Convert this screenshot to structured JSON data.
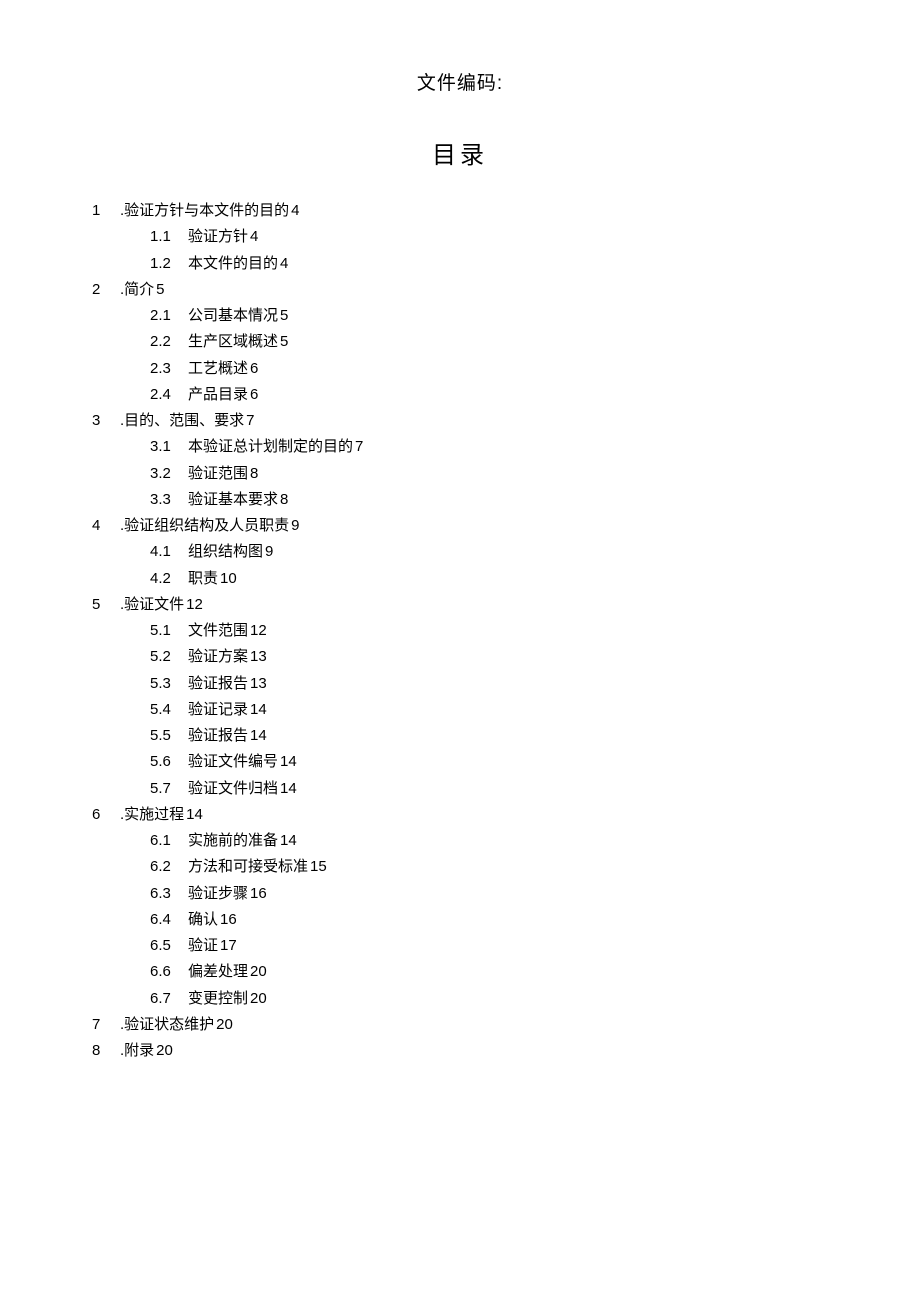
{
  "header": "文件编码:",
  "title": "目录",
  "toc": [
    {
      "level": 1,
      "num": "1",
      "label": ".验证方针与本文件的目的",
      "page": "4"
    },
    {
      "level": 2,
      "num": "1.1",
      "label": "验证方针",
      "page": "4"
    },
    {
      "level": 2,
      "num": "1.2",
      "label": "本文件的目的",
      "page": "4"
    },
    {
      "level": 1,
      "num": "2",
      "label": ".简介",
      "page": "5"
    },
    {
      "level": 2,
      "num": "2.1",
      "label": "公司基本情况",
      "page": "5"
    },
    {
      "level": 2,
      "num": "2.2",
      "label": "生产区域概述",
      "page": "5"
    },
    {
      "level": 2,
      "num": "2.3",
      "label": "工艺概述",
      "page": "6"
    },
    {
      "level": 2,
      "num": "2.4",
      "label": "产品目录",
      "page": "6"
    },
    {
      "level": 1,
      "num": "3",
      "label": ".目的、范围、要求",
      "page": "7"
    },
    {
      "level": 2,
      "num": "3.1",
      "label": "本验证总计划制定的目的",
      "page": "7"
    },
    {
      "level": 2,
      "num": "3.2",
      "label": "验证范围",
      "page": "8"
    },
    {
      "level": 2,
      "num": "3.3",
      "label": "验证基本要求",
      "page": "8"
    },
    {
      "level": 1,
      "num": "4",
      "label": ".验证组织结构及人员职责",
      "page": "9"
    },
    {
      "level": 2,
      "num": "4.1",
      "label": "组织结构图",
      "page": "9"
    },
    {
      "level": 2,
      "num": "4.2",
      "label": "职责",
      "page": "10"
    },
    {
      "level": 1,
      "num": "5",
      "label": ".验证文件",
      "page": "12"
    },
    {
      "level": 2,
      "num": "5.1",
      "label": "文件范围",
      "page": "12"
    },
    {
      "level": 2,
      "num": "5.2",
      "label": "验证方案",
      "page": "13"
    },
    {
      "level": 2,
      "num": "5.3",
      "label": "验证报告",
      "page": "13"
    },
    {
      "level": 2,
      "num": "5.4",
      "label": "验证记录",
      "page": "14"
    },
    {
      "level": 2,
      "num": "5.5",
      "label": "验证报告",
      "page": "14"
    },
    {
      "level": 2,
      "num": "5.6",
      "label": "验证文件编号",
      "page": "14"
    },
    {
      "level": 2,
      "num": "5.7",
      "label": "验证文件归档",
      "page": "14"
    },
    {
      "level": 1,
      "num": "6",
      "label": ".实施过程",
      "page": "14"
    },
    {
      "level": 2,
      "num": "6.1",
      "label": "实施前的准备",
      "page": "14"
    },
    {
      "level": 2,
      "num": "6.2",
      "label": "方法和可接受标准",
      "page": "15"
    },
    {
      "level": 2,
      "num": "6.3",
      "label": "验证步骤",
      "page": "16"
    },
    {
      "level": 2,
      "num": "6.4",
      "label": "确认",
      "page": "16"
    },
    {
      "level": 2,
      "num": "6.5",
      "label": "验证",
      "page": "17"
    },
    {
      "level": 2,
      "num": "6.6",
      "label": "偏差处理",
      "page": "20"
    },
    {
      "level": 2,
      "num": "6.7",
      "label": "变更控制",
      "page": "20"
    },
    {
      "level": 1,
      "num": "7",
      "label": ".验证状态维护",
      "page": "20"
    },
    {
      "level": 1,
      "num": "8",
      "label": ".附录",
      "page": "20"
    }
  ]
}
